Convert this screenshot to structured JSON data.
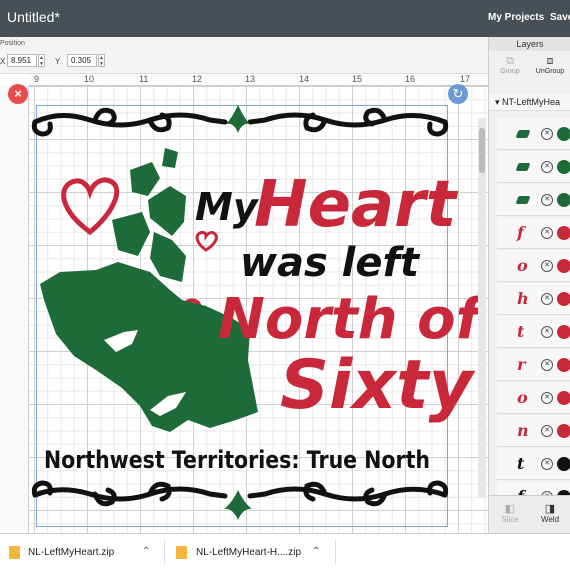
{
  "app": {
    "title": "Untitled*",
    "my_projects": "My Projects",
    "save": "Save"
  },
  "position": {
    "label": "Position",
    "x_label": "X",
    "x_value": "8.951",
    "y_label": "Y",
    "y_value": "0.305"
  },
  "ruler": {
    "ticks": [
      "9",
      "10",
      "11",
      "12",
      "13",
      "14",
      "15",
      "16",
      "17"
    ],
    "side_label": "7."
  },
  "design": {
    "line1": "My",
    "line2": "Heart",
    "line3": "was left",
    "line4": "North of",
    "line5": "Sixty",
    "footer": "Northwest Territories: True North",
    "colors": {
      "red": "#c8283a",
      "green": "#1e6b3a",
      "black": "#111111"
    }
  },
  "layers": {
    "header": "Layers",
    "group": "Group",
    "ungroup": "UnGroup",
    "group_name": "NT-LeftMyHea",
    "items": [
      {
        "glyph": "",
        "color": "#1e6b3a"
      },
      {
        "glyph": "",
        "color": "#1e6b3a"
      },
      {
        "glyph": "",
        "color": "#1e6b3a"
      },
      {
        "glyph": "f",
        "color": "#c8283a"
      },
      {
        "glyph": "o",
        "color": "#c8283a"
      },
      {
        "glyph": "h",
        "color": "#c8283a"
      },
      {
        "glyph": "t",
        "color": "#c8283a"
      },
      {
        "glyph": "r",
        "color": "#c8283a"
      },
      {
        "glyph": "o",
        "color": "#c8283a"
      },
      {
        "glyph": "n",
        "color": "#c8283a"
      },
      {
        "glyph": "t",
        "color": "#111111"
      },
      {
        "glyph": "f",
        "color": "#111111"
      }
    ],
    "slice": "Slice",
    "weld": "Weld"
  },
  "downloads": [
    {
      "name": "NL-LeftMyHeart.zip"
    },
    {
      "name": "NL-LeftMyHeart-H....zip"
    }
  ]
}
